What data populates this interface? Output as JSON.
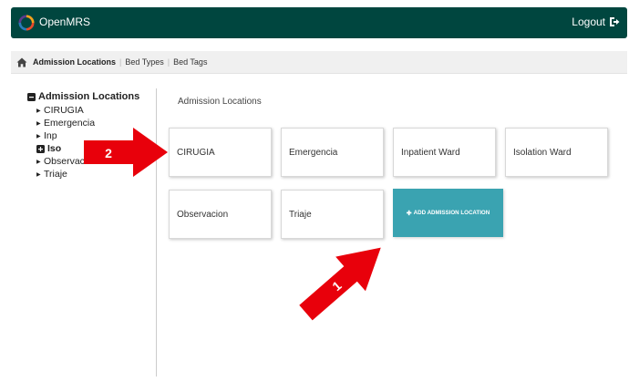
{
  "app": {
    "logo_text": "OpenMRS",
    "logo_subtitle": "",
    "logout_label": "Logout"
  },
  "breadcrumb": {
    "items": [
      "Admission Locations",
      "Bed Types",
      "Bed Tags"
    ]
  },
  "sidebar": {
    "root_label": "Admission Locations",
    "items": [
      "CIRUGIA",
      "Emergencia",
      "Inp",
      "Iso",
      "Observacion",
      "Triaje"
    ]
  },
  "main": {
    "title": "Admission Locations",
    "tiles": [
      "CIRUGIA",
      "Emergencia",
      "Inpatient Ward",
      "Isolation Ward",
      "Observacion",
      "Triaje"
    ],
    "add_button_label": "ADD ADMISSION LOCATION"
  },
  "annotations": {
    "arrow_1_label": "1",
    "arrow_2_label": "2"
  },
  "colors": {
    "header": "#00463f",
    "accent": "#3aa3b1",
    "arrow": "#e8000b"
  },
  "icons": [
    "openmrs-logo-icon",
    "logout-icon",
    "home-icon",
    "collapse-icon",
    "expand-icon",
    "caret-right-icon",
    "plus-icon"
  ]
}
